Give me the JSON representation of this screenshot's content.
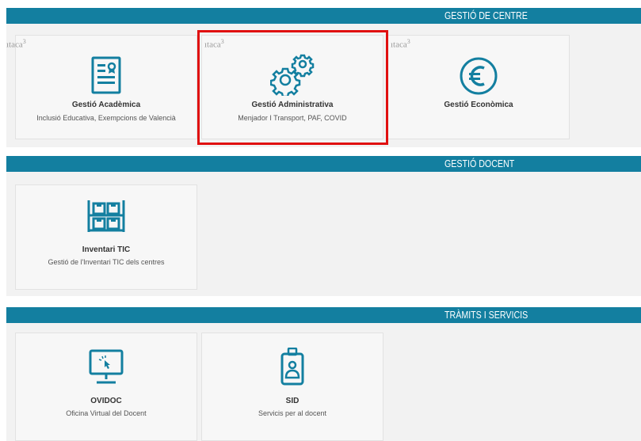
{
  "sections": [
    {
      "header": "GESTIÓ DE CENTRE",
      "cards": [
        {
          "brand": "ıtaca",
          "brand_sup": "3",
          "title": "Gestió Acadèmica",
          "subtitle": "Inclusió Educativa, Exempcions de Valencià",
          "icon": "document-user-icon"
        },
        {
          "brand": "ıtaca",
          "brand_sup": "3",
          "title": "Gestió Administrativa",
          "subtitle": "Menjador I Transport, PAF, COVID",
          "icon": "gears-icon"
        },
        {
          "brand": "ıtaca",
          "brand_sup": "3",
          "title": "Gestió Econòmica",
          "subtitle": "",
          "icon": "euro-icon"
        }
      ]
    },
    {
      "header": "GESTIÓ DOCENT",
      "cards": [
        {
          "title": "Inventari TIC",
          "subtitle": "Gestió de l'Inventari TIC dels centres",
          "icon": "shelves-icon"
        }
      ]
    },
    {
      "header": "TRÀMITS I SERVICIS",
      "cards": [
        {
          "title": "OVIDOC",
          "subtitle": "Oficina Virtual del Docent",
          "icon": "monitor-click-icon"
        },
        {
          "title": "SID",
          "subtitle": "Servicis per al docent",
          "icon": "id-badge-icon"
        }
      ]
    }
  ],
  "colors": {
    "header_bg": "#137fa0",
    "icon": "#137fa0",
    "highlight": "#e01010"
  }
}
